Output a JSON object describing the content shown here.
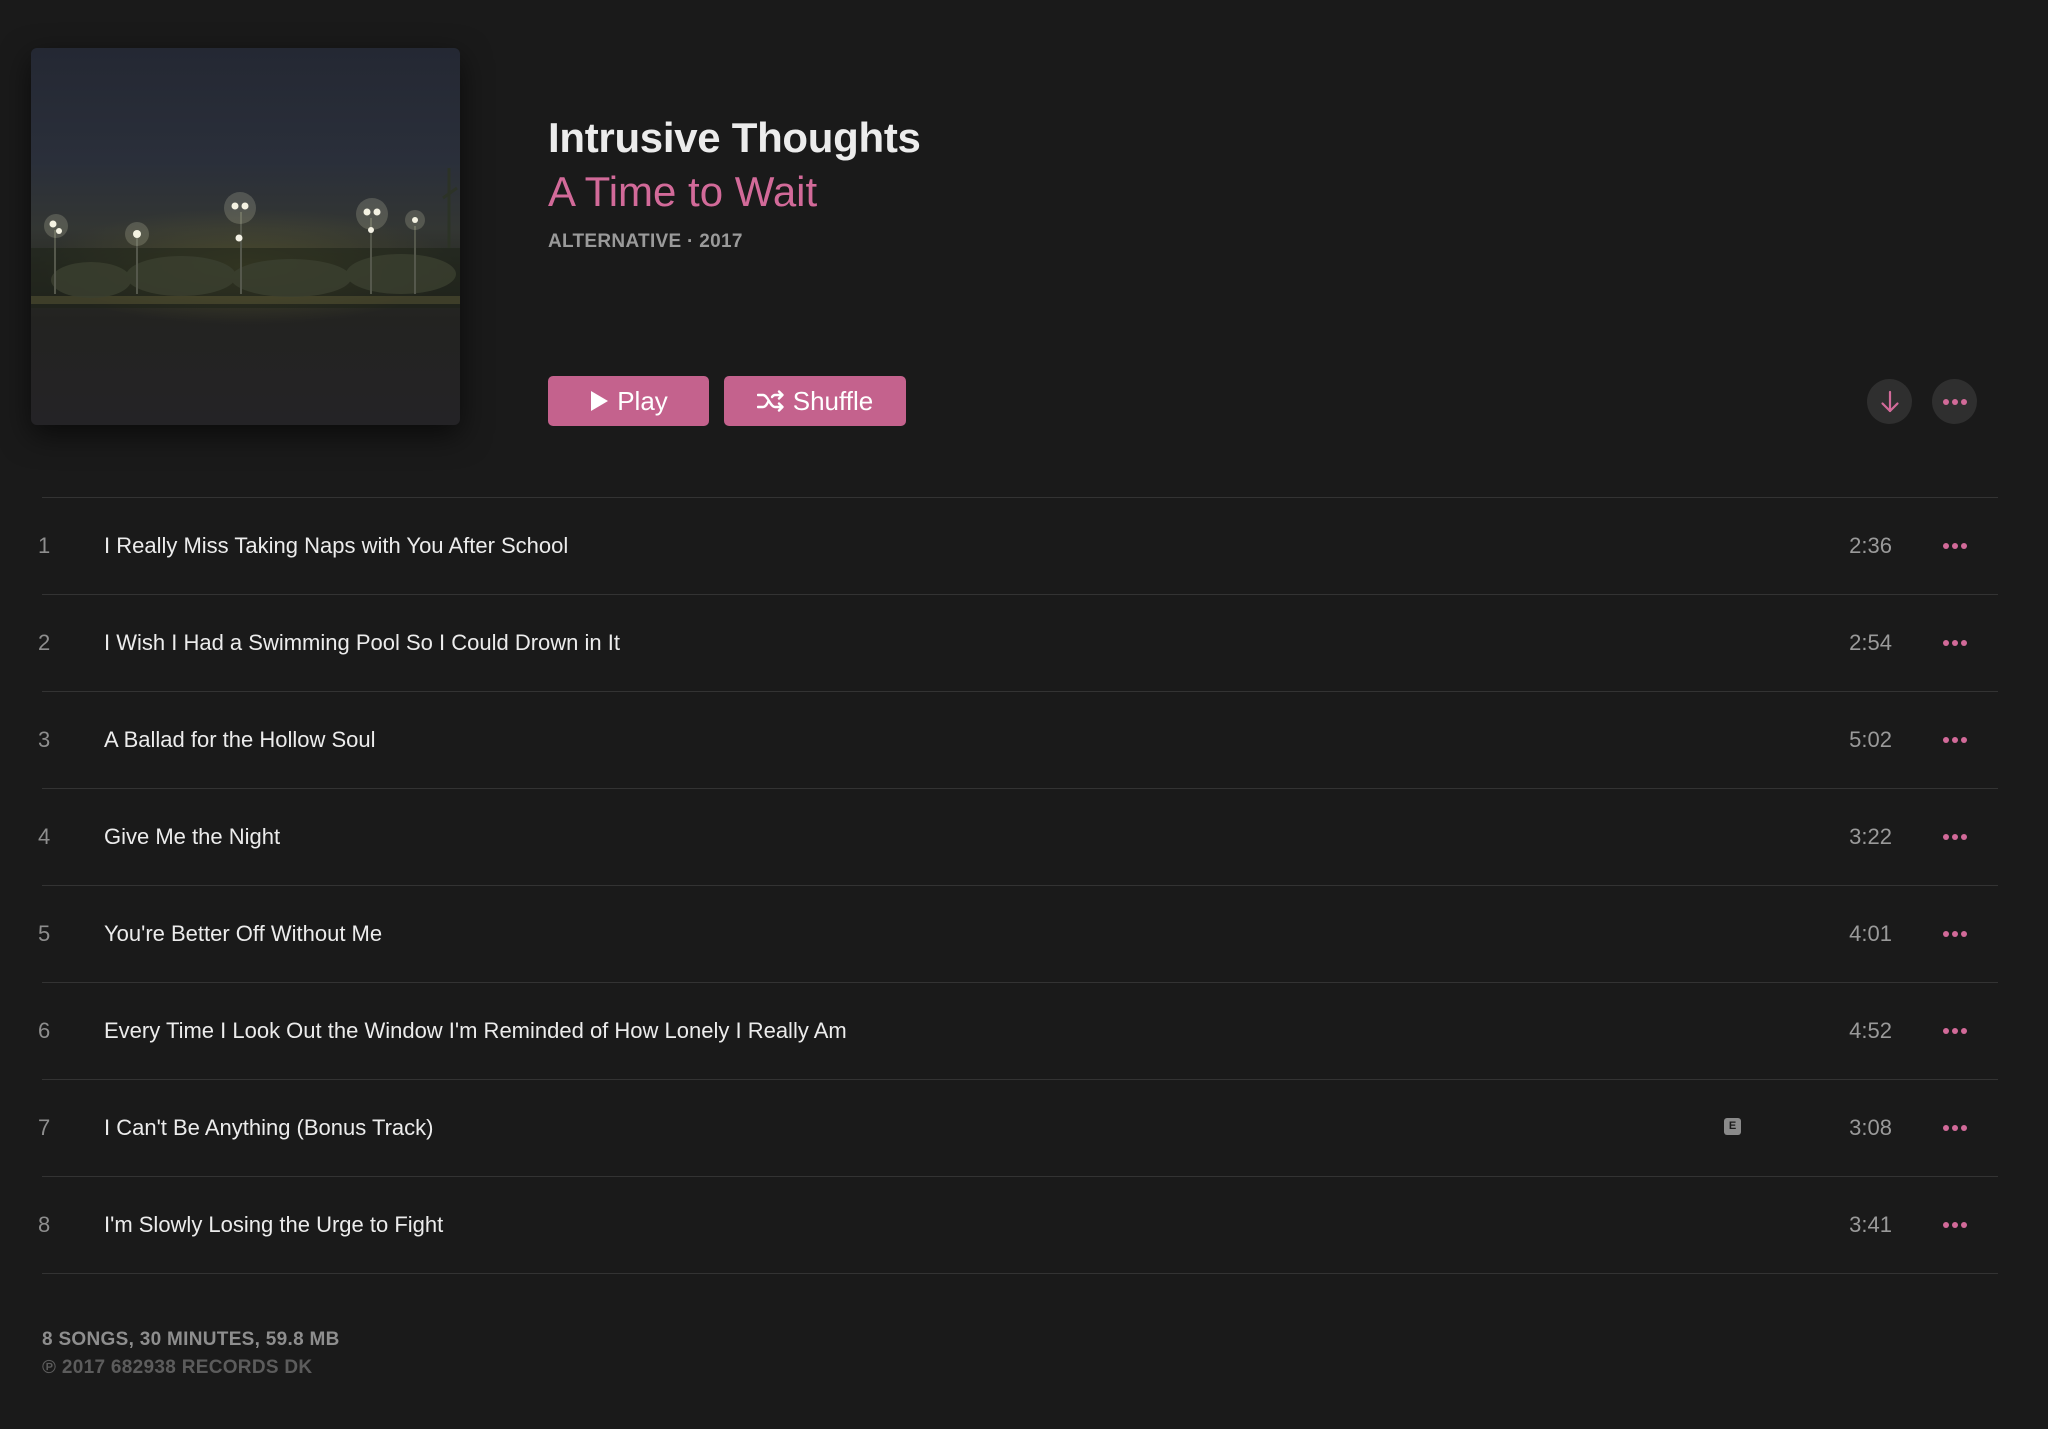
{
  "album": {
    "title": "Intrusive Thoughts",
    "artist": "A Time to Wait",
    "meta": "ALTERNATIVE · 2017",
    "artwork_icon": "album-artwork-stadium-lights-at-night"
  },
  "actions": {
    "play_label": "Play",
    "play_icon": "play-icon",
    "shuffle_label": "Shuffle",
    "shuffle_icon": "shuffle-icon",
    "download_icon": "download-arrow-icon",
    "more_icon": "more-ellipsis-icon"
  },
  "tracks": [
    {
      "number": "1",
      "title": "I Really Miss Taking Naps with You After School",
      "duration": "2:36",
      "explicit": false
    },
    {
      "number": "2",
      "title": "I Wish I Had a Swimming Pool So I Could Drown in It",
      "duration": "2:54",
      "explicit": false
    },
    {
      "number": "3",
      "title": "A Ballad for the Hollow Soul",
      "duration": "5:02",
      "explicit": false
    },
    {
      "number": "4",
      "title": "Give Me the Night",
      "duration": "3:22",
      "explicit": false
    },
    {
      "number": "5",
      "title": "You're Better Off Without Me",
      "duration": "4:01",
      "explicit": false
    },
    {
      "number": "6",
      "title": "Every Time I Look Out the Window I'm Reminded of How Lonely I Really Am",
      "duration": "4:52",
      "explicit": false
    },
    {
      "number": "7",
      "title": "I Can't Be Anything (Bonus Track)",
      "duration": "3:08",
      "explicit": true,
      "explicit_label": "E"
    },
    {
      "number": "8",
      "title": "I'm Slowly Losing the Urge to Fight",
      "duration": "3:41",
      "explicit": false
    }
  ],
  "footer": {
    "summary": "8 SONGS, 30 MINUTES, 59.8 MB",
    "copyright": "℗ 2017 682938 RECORDS DK"
  },
  "colors": {
    "background": "#1a1a1a",
    "accent": "#c4628d",
    "artist_text": "#d26a99",
    "divider": "#333333"
  }
}
